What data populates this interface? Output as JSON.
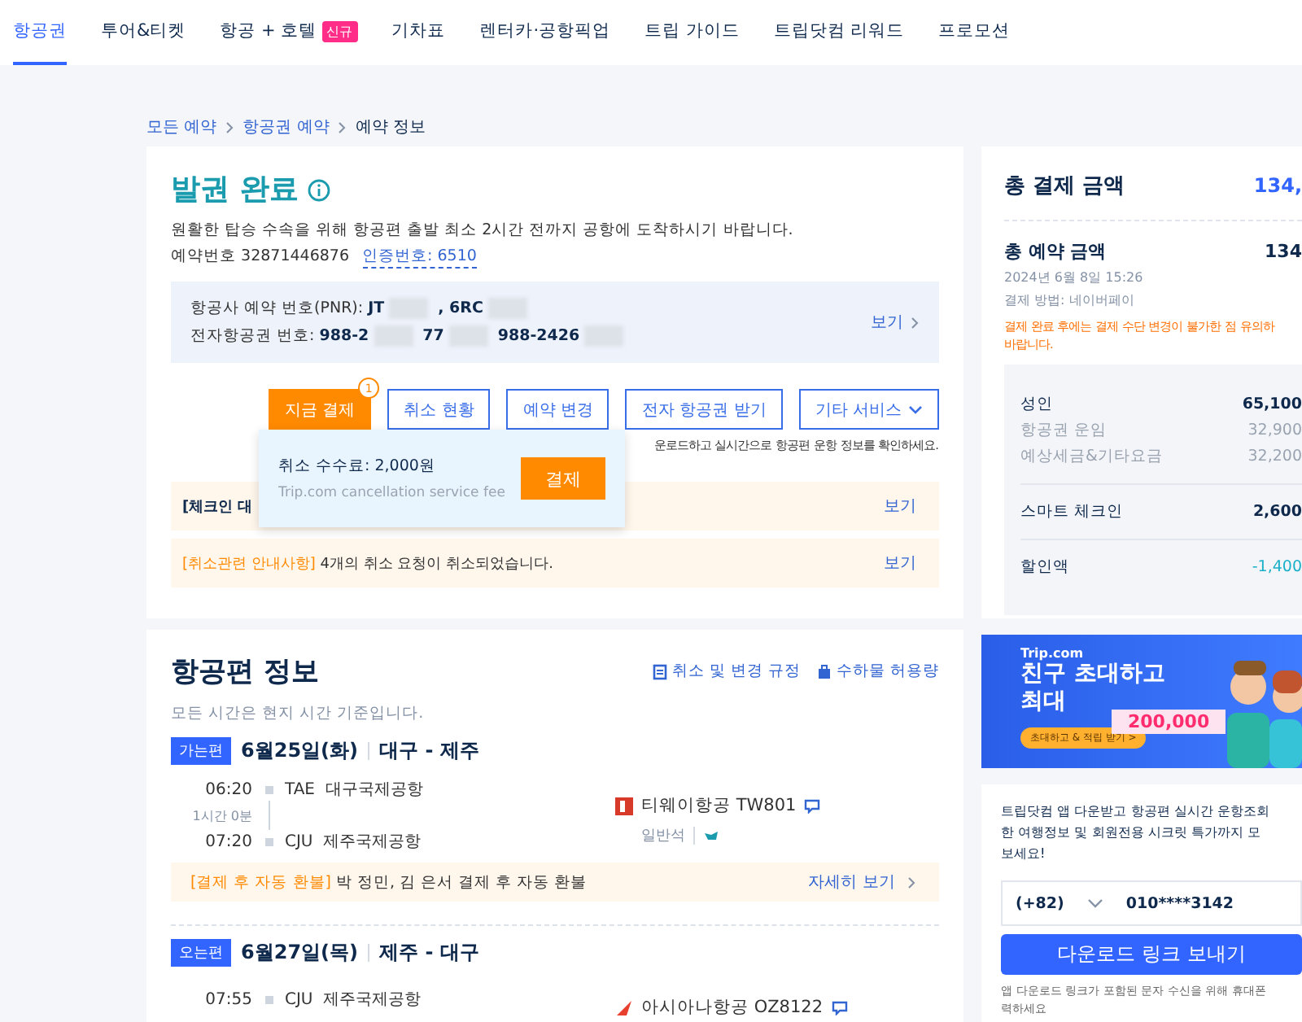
{
  "nav": {
    "tabs": [
      {
        "label": "항공권",
        "selected": true
      },
      {
        "label": "투어&티켓",
        "selected": false
      },
      {
        "label": "항공 + 호텔",
        "selected": false,
        "badge": "신규"
      },
      {
        "label": "기차표",
        "selected": false
      },
      {
        "label": "렌터카·공항픽업",
        "selected": false
      },
      {
        "label": "트립 가이드",
        "selected": false
      },
      {
        "label": "트립닷컴 리워드",
        "selected": false
      },
      {
        "label": "프로모션",
        "selected": false
      }
    ]
  },
  "breadcrumb": [
    "모든 예약",
    "항공권 예약",
    "예약 정보"
  ],
  "booking": {
    "title": "발권 완료",
    "notice": "원활한 탑승 수속을 위해 항공편 출발 최소 2시간 전까지 공항에 도착하시기 바랍니다.",
    "booking_no_label": "예약번호",
    "booking_no": "32871446876",
    "auth_code": "인증번호: 6510",
    "pnr": {
      "lines": [
        {
          "label": "항공사 예약 번호(PNR):",
          "parts": [
            {
              "kind": "text",
              "text": "JT"
            },
            {
              "kind": "mask"
            },
            {
              "kind": "text",
              "text": ", 6RC"
            },
            {
              "kind": "mask"
            }
          ]
        },
        {
          "label": "전자항공권 번호:",
          "parts": [
            {
              "kind": "text",
              "text": "988-2"
            },
            {
              "kind": "mask"
            },
            {
              "kind": "text",
              "text": "77"
            },
            {
              "kind": "mask"
            },
            {
              "kind": "text",
              "text": "988-2426"
            },
            {
              "kind": "mask"
            }
          ]
        }
      ],
      "link": "보기"
    },
    "actions": [
      {
        "label": "지금 결제",
        "kind": "primary",
        "badge": "1"
      },
      {
        "label": "취소 현황",
        "kind": "outline"
      },
      {
        "label": "예약 변경",
        "kind": "outline"
      },
      {
        "label": "전자 항공권 받기",
        "kind": "outline"
      },
      {
        "label": "기타 서비스",
        "kind": "dropdown"
      }
    ],
    "helper": "운로드하고 실시간으로 항공편 운항 정보를 확인하세요.",
    "popover": {
      "fee": "취소 수수료: 2,000원",
      "caption": "Trip.com cancellation service fee",
      "button": "결제"
    },
    "notices": [
      {
        "text": "[체크인 대",
        "link": "보기"
      },
      {
        "tag": "[취소관련 안내사항]",
        "text": "4개의 취소 요청이 취소되었습니다.",
        "link": "보기"
      }
    ]
  },
  "flights": {
    "title": "항공편 정보",
    "links": [
      {
        "label": "취소 및 변경 규정"
      },
      {
        "label": "수하물 허용량"
      }
    ],
    "note": "모든 시간은 현지 시간 기준입니다.",
    "legs": [
      {
        "badge": "가는편",
        "date": "6월25일(화)",
        "route": "대구 - 제주",
        "stops": [
          {
            "time": "06:20",
            "code": "TAE",
            "airport": "대구국제공항"
          },
          {
            "time": "07:20",
            "code": "CJU",
            "airport": "제주국제공항"
          }
        ],
        "duration": "1시간 0분",
        "airline": "티웨이항공 TW801",
        "cabin": "일반석",
        "refund": {
          "tag": "[결제 후 자동 환불]",
          "text": "박 정민, 김 은서 결제 후 자동 환불",
          "link": "자세히 보기"
        }
      },
      {
        "badge": "오는편",
        "date": "6월27일(목)",
        "route": "제주 - 대구",
        "stops": [
          {
            "time": "07:55",
            "code": "CJU",
            "airport": "제주국제공항"
          }
        ],
        "airline": "아시아나항공 OZ8122"
      }
    ]
  },
  "summary": {
    "title": "총 결제 금액",
    "total": "134,",
    "booked_label": "총 예약 금액",
    "booked": "134",
    "date": "2024년 6월 8일 15:26",
    "method": "결제 방법: 네이버페이",
    "warning_lines": [
      "결제 완료 후에는 결제 수단 변경이 불가한 점 유의하",
      "바랍니다."
    ],
    "groups": [
      {
        "rows": [
          {
            "label": "성인",
            "value": "65,100",
            "kind": "main"
          },
          {
            "label": "항공권 운임",
            "value": "32,900",
            "kind": "sub"
          },
          {
            "label": "예상세금&기타요금",
            "value": "32,200",
            "kind": "sub"
          }
        ]
      },
      {
        "rows": [
          {
            "label": "스마트 체크인",
            "value": "2,600",
            "kind": "main"
          }
        ]
      },
      {
        "rows": [
          {
            "label": "할인액",
            "value": "-1,400",
            "kind": "discount"
          }
        ]
      }
    ]
  },
  "banner": {
    "brand": "Trip.com",
    "lines": [
      "친구 초대하고",
      "최대"
    ],
    "amount": "200,000",
    "button": "초대하고 & 적립 받기 >"
  },
  "download": {
    "lines": [
      "트립닷컴 앱 다운받고 항공편 실시간 운항조회",
      "한 여행정보 및 회원전용 시크릿 특가까지 모",
      "보세요!"
    ],
    "country_code": "(+82)",
    "phone": "010****3142",
    "button": "다운로드 링크 보내기",
    "footnote_lines": [
      "앱 다운로드 링크가 포함된 문자 수신을 위해 휴대폰",
      "력하세요"
    ]
  }
}
